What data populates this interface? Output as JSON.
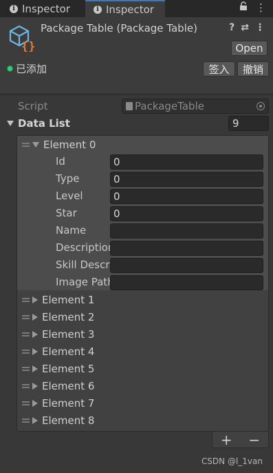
{
  "tabs": [
    {
      "label": "Inspector"
    },
    {
      "label": "Inspector"
    }
  ],
  "tab_icons": [
    "lock-icon",
    "more-menu-icon"
  ],
  "header": {
    "title": "Package Table (Package Table)",
    "open_label": "Open",
    "status_text": "已添加",
    "checkin_label": "签入",
    "undo_label": "撤销",
    "help_icon": "?",
    "settings_icon": "⇄",
    "menu_icon": "⋮"
  },
  "script": {
    "label": "Script",
    "value": "PackageTable"
  },
  "data_list": {
    "label": "Data List",
    "size": "9",
    "element0": {
      "label": "Element 0",
      "fields": [
        {
          "label": "Id",
          "value": "0"
        },
        {
          "label": "Type",
          "value": "0"
        },
        {
          "label": "Level",
          "value": "0"
        },
        {
          "label": "Star",
          "value": "0"
        },
        {
          "label": "Name",
          "value": ""
        },
        {
          "label": "Description",
          "value": ""
        },
        {
          "label": "Skill Description",
          "value": ""
        },
        {
          "label": "Image Path",
          "value": ""
        }
      ]
    },
    "collapsed": [
      "Element 1",
      "Element 2",
      "Element 3",
      "Element 4",
      "Element 5",
      "Element 6",
      "Element 7",
      "Element 8"
    ],
    "add_label": "+",
    "remove_label": "−"
  },
  "watermark": "CSDN @l_1van",
  "colors": {
    "status_green": "#2fcf74",
    "asset_icon_blue": "#6fb8e6",
    "asset_icon_orange": "#e8793a",
    "tab_accent": "#3a79bb"
  }
}
